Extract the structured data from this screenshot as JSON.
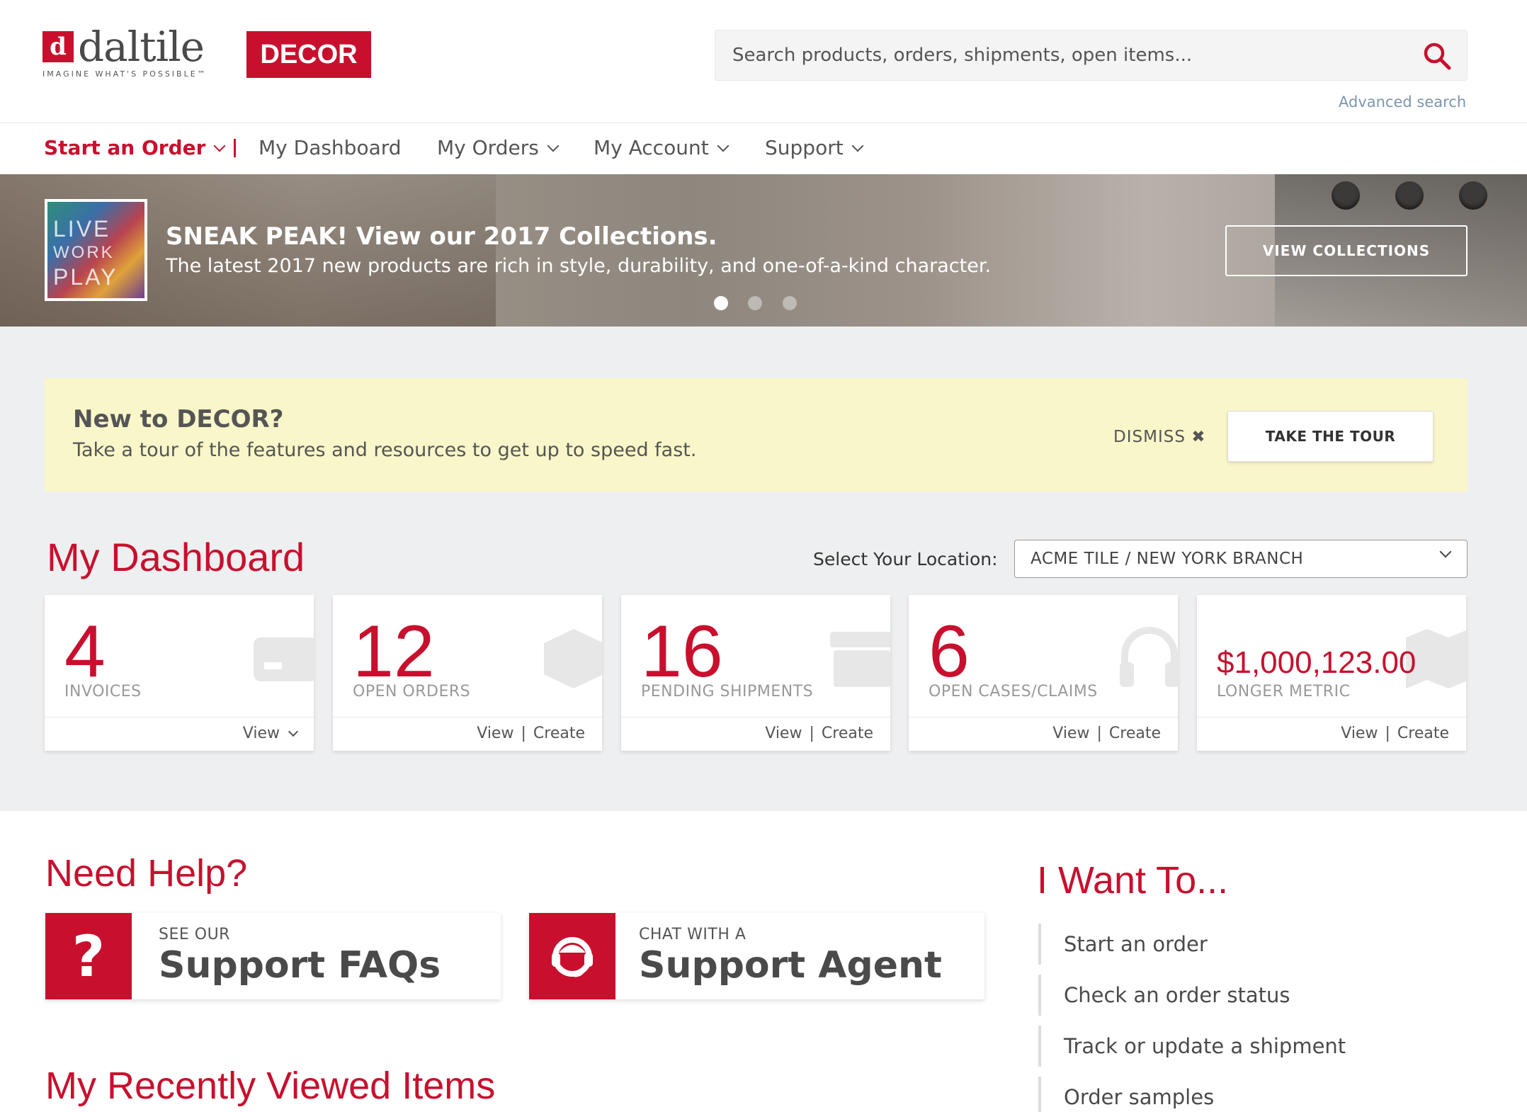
{
  "brand": {
    "name": "daltile",
    "tagline": "IMAGINE WHAT'S POSSIBLE™",
    "app_badge": "DECOR",
    "accent": "#c8102e"
  },
  "search": {
    "placeholder": "Search products, orders, shipments, open items...",
    "advanced_link": "Advanced search"
  },
  "nav": {
    "start_order": "Start an Order",
    "items": [
      {
        "label": "My Dashboard"
      },
      {
        "label": "My Orders"
      },
      {
        "label": "My Account"
      },
      {
        "label": "Support"
      }
    ]
  },
  "hero": {
    "thumb_words": [
      "LIVE",
      "WORK",
      "PLAY"
    ],
    "title": "SNEAK PEAK! View our 2017 Collections.",
    "subtitle": "The latest 2017 new products are rich in style, durability, and one-of-a-kind character.",
    "button": "VIEW COLLECTIONS",
    "slides": 3,
    "active_slide": 1
  },
  "tour": {
    "title": "New to DECOR?",
    "subtitle": "Take a tour of the features and resources to get up to speed fast.",
    "dismiss": "DISMISS ✖",
    "button": "TAKE THE TOUR"
  },
  "dashboard": {
    "title": "My Dashboard",
    "location_label": "Select Your Location:",
    "location_value": "ACME TILE / NEW YORK BRANCH",
    "cards": [
      {
        "value": "4",
        "label": "INVOICES",
        "view": "View",
        "create": ""
      },
      {
        "value": "12",
        "label": "OPEN ORDERS",
        "view": "View",
        "create": "Create"
      },
      {
        "value": "16",
        "label": "PENDING SHIPMENTS",
        "view": "View",
        "create": "Create"
      },
      {
        "value": "6",
        "label": "OPEN CASES/CLAIMS",
        "view": "View",
        "create": "Create"
      },
      {
        "value": "$1,000,123.00",
        "label": "LONGER METRIC",
        "view": "View",
        "create": "Create"
      }
    ]
  },
  "help": {
    "title": "Need Help?",
    "faq_small": "SEE OUR",
    "faq_big": "Support FAQs",
    "agent_small": "CHAT WITH A",
    "agent_big": "Support Agent"
  },
  "recent": {
    "title": "My Recently Viewed Items"
  },
  "want": {
    "title": "I Want To...",
    "items": [
      "Start an order",
      "Check an order status",
      "Track or update a shipment",
      "Order samples"
    ]
  }
}
